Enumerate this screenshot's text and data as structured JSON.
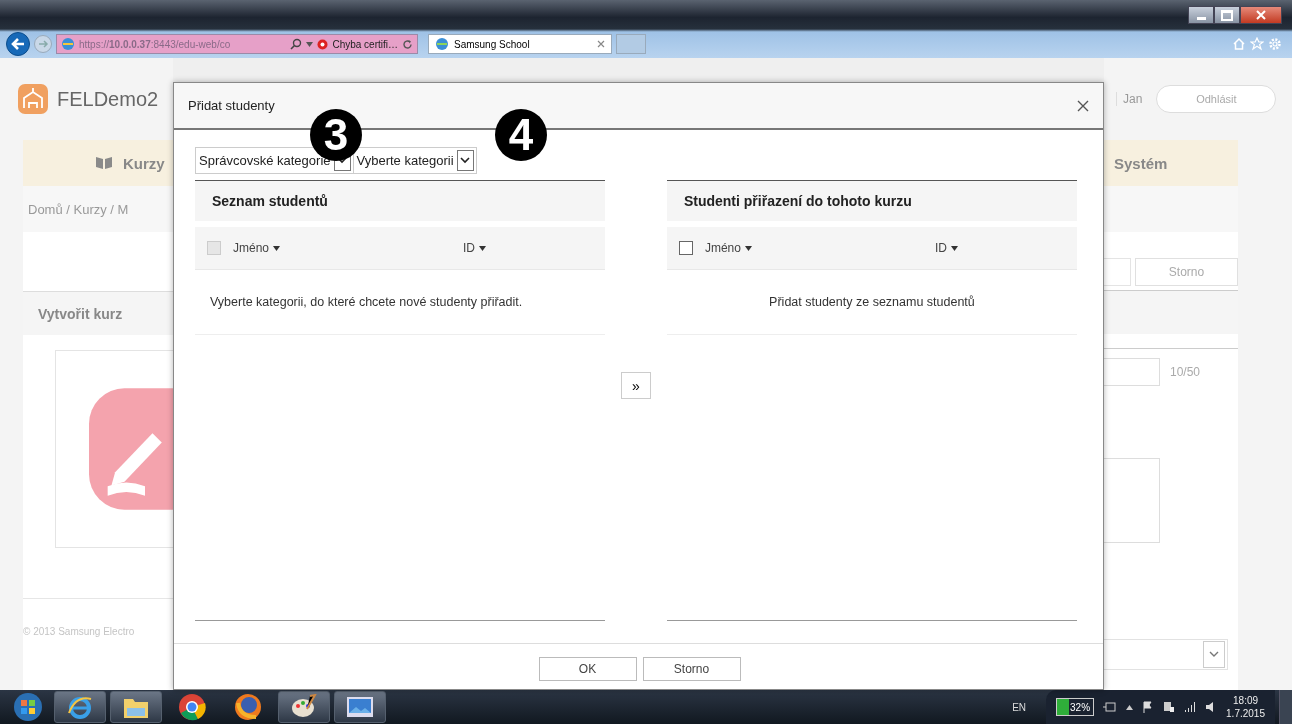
{
  "browser": {
    "address": "https://**10.0.0.37**:8443/edu-web/co",
    "certificate_error": "Chyba certifi…",
    "tabs": [
      {
        "title": "Samsung School",
        "selected": true
      }
    ]
  },
  "page": {
    "app_name": "FELDemo2",
    "user": "Jan",
    "logout": "Odhlásit",
    "nav": [
      {
        "label": "Kurzy"
      },
      {
        "label": "Systém"
      }
    ],
    "breadcrumb": "Domů / Kurzy / M",
    "panel_title": "Vytvořit kurz",
    "cancel": "Storno",
    "counter": "10/50",
    "footer": "© 2013 Samsung Electro"
  },
  "dialog": {
    "title": "Přidat studenty",
    "dropdowns": [
      {
        "value": "Správcovské kategorie"
      },
      {
        "value": "Vyberte kategorii"
      }
    ],
    "lists": [
      {
        "title": "Seznam studentů",
        "select_all": {
          "checked": false,
          "disabled": true
        },
        "columns": [
          "Jméno",
          "ID"
        ],
        "message": "Vyberte kategorii, do které chcete nové studenty přiřadit."
      },
      {
        "title": "Studenti přiřazení do tohoto kurzu",
        "select_all": {
          "checked": false,
          "disabled": false
        },
        "columns": [
          "Jméno",
          "ID"
        ],
        "message": "Přidat studenty ze seznamu studentů"
      }
    ],
    "move_button": "»",
    "buttons": [
      "OK",
      "Storno"
    ]
  },
  "annotations": [
    "3",
    "4"
  ],
  "taskbar": {
    "apps": [
      {
        "kind": "start"
      },
      {
        "kind": "ie",
        "running": true
      },
      {
        "kind": "folder",
        "running": true
      },
      {
        "kind": "chrome",
        "running": false
      },
      {
        "kind": "firefox",
        "running": false
      },
      {
        "kind": "paint",
        "running": true
      },
      {
        "kind": "photo",
        "running": true
      }
    ],
    "language": "EN",
    "battery": "32%",
    "time": "18:09",
    "date": "1.7.2015"
  }
}
